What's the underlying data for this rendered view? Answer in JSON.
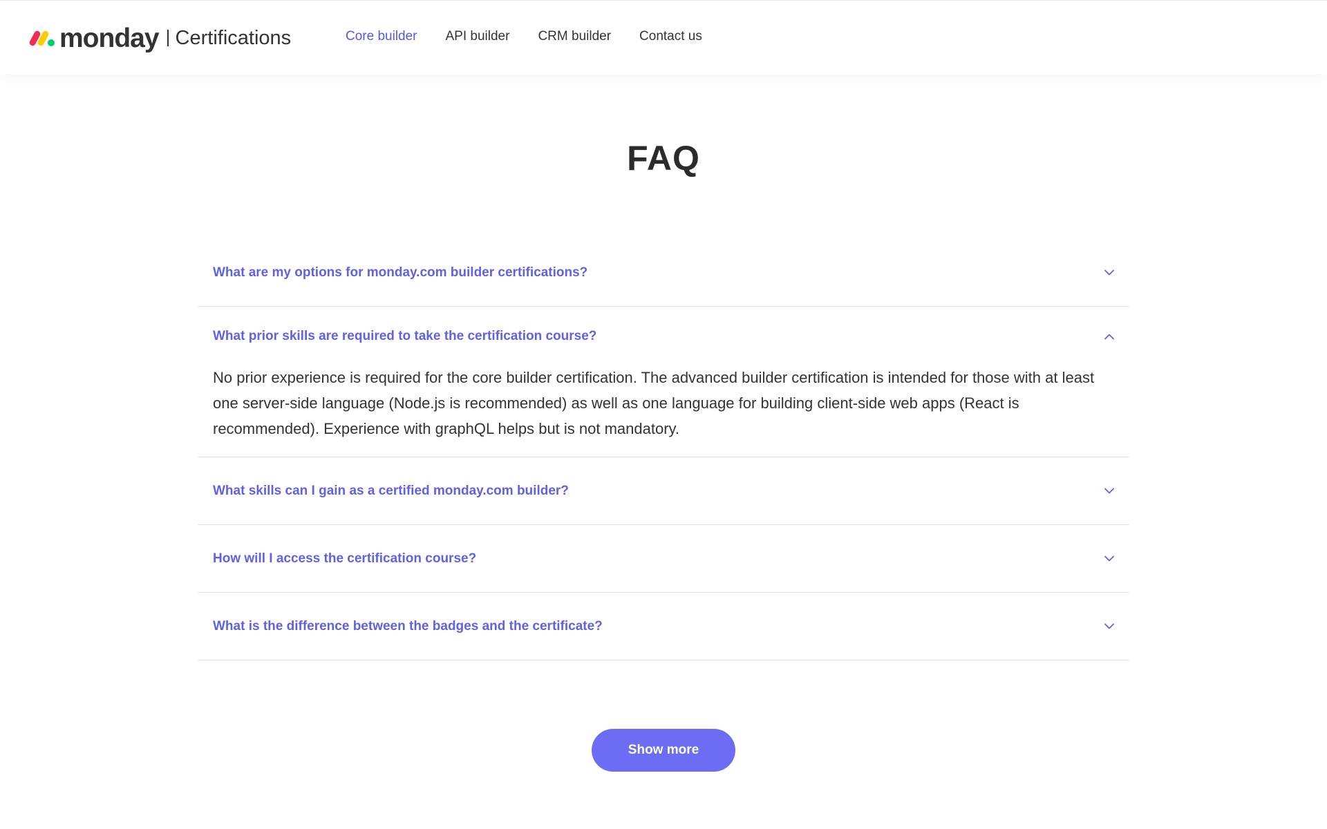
{
  "header": {
    "logo_word": "monday",
    "logo_sub": "Certifications",
    "nav": [
      {
        "label": "Core builder",
        "active": true
      },
      {
        "label": "API builder",
        "active": false
      },
      {
        "label": "CRM builder",
        "active": false
      },
      {
        "label": "Contact us",
        "active": false
      }
    ]
  },
  "faq": {
    "title": "FAQ",
    "items": [
      {
        "question": "What are my options for monday.com builder certifications?",
        "expanded": false,
        "icon": "chevron-down-icon"
      },
      {
        "question": "What prior skills are required to take the certification course?",
        "expanded": true,
        "icon": "chevron-up-icon",
        "answer": "No prior experience is required for the core builder certification. The advanced builder certification is intended for those with at least one server-side language (Node.js is recommended) as well as one language for building client-side web apps (React is recommended). Experience with graphQL helps but is not mandatory."
      },
      {
        "question": "What skills can I gain as a certified monday.com builder?",
        "expanded": false,
        "icon": "chevron-down-icon"
      },
      {
        "question": "How will I access the certification course?",
        "expanded": false,
        "icon": "chevron-down-icon"
      },
      {
        "question": "What is the difference between the badges and the certificate?",
        "expanded": false,
        "icon": "chevron-down-icon"
      }
    ],
    "show_more_label": "Show more"
  },
  "colors": {
    "accent": "#6161e3",
    "button": "#6c6cf5",
    "logo_red": "#f62b54",
    "logo_yellow": "#ffcc00",
    "logo_green": "#00ca72"
  }
}
